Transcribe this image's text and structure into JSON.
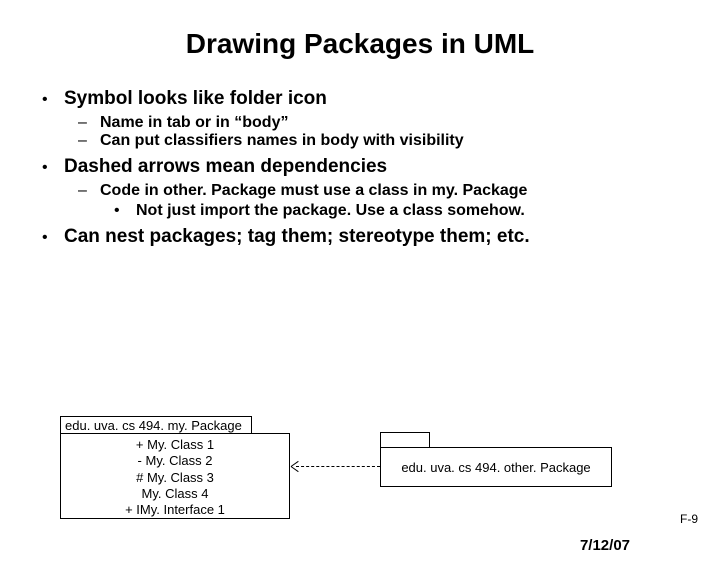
{
  "title": "Drawing Packages in UML",
  "bullets": {
    "b1": "Symbol looks like folder icon",
    "b1a": "Name in tab or in “body”",
    "b1b": "Can put classifiers names in body with visibility",
    "b2": "Dashed arrows mean dependencies",
    "b2a": "Code in other. Package must use a class in my. Package",
    "b2a1": "Not just import the package.  Use a class somehow.",
    "b3": "Can nest packages; tag them; stereotype them; etc."
  },
  "diagram": {
    "pkg1_tab": "edu. uva. cs 494. my. Package",
    "pkg1_items": {
      "i1": "+ My. Class 1",
      "i2": "- My. Class 2",
      "i3": "# My. Class 3",
      "i4": "My. Class 4",
      "i5": "+ IMy. Interface 1"
    },
    "pkg2_label": "edu. uva. cs 494. other. Package"
  },
  "slide_number": "F-9",
  "date": "7/12/07"
}
